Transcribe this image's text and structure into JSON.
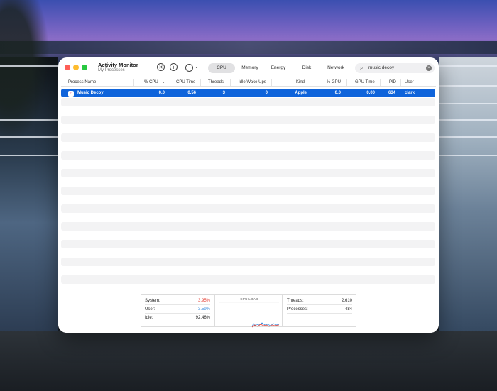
{
  "window": {
    "title": "Activity Monitor",
    "subtitle": "My Processes"
  },
  "toolbar": {
    "stop_icon": "x-circle-icon",
    "info_icon": "info-icon",
    "more_icon": "ellipsis-icon",
    "more_chevron": "⌄"
  },
  "tabs": [
    {
      "label": "CPU",
      "active": true
    },
    {
      "label": "Memory",
      "active": false
    },
    {
      "label": "Energy",
      "active": false
    },
    {
      "label": "Disk",
      "active": false
    },
    {
      "label": "Network",
      "active": false
    }
  ],
  "search": {
    "value": "music decoy"
  },
  "columns": {
    "process_name": "Process Name",
    "cpu": "% CPU",
    "cpu_time": "CPU Time",
    "threads": "Threads",
    "idle_wake_ups": "Idle Wake Ups",
    "kind": "Kind",
    "gpu": "% GPU",
    "gpu_time": "GPU Time",
    "pid": "PID",
    "user": "User"
  },
  "process": {
    "name": "Music Decoy",
    "cpu": "0.0",
    "cpu_time": "0.56",
    "threads": "3",
    "idle_wake_ups": "0",
    "kind": "Apple",
    "gpu": "0.0",
    "gpu_time": "0.00",
    "pid": "634",
    "user": "clark"
  },
  "stats": {
    "system_label": "System:",
    "system_value": "3.95%",
    "system_color": "#e5443a",
    "user_label": "User:",
    "user_value": "3.59%",
    "user_color": "#3d8fe0",
    "idle_label": "Idle:",
    "idle_value": "92.46%",
    "cpu_load_label": "CPU LOAD",
    "threads_label": "Threads:",
    "threads_value": "2,610",
    "processes_label": "Processes:",
    "processes_value": "484"
  },
  "colors": {
    "selection": "#0f64db",
    "accent_red": "#e5443a",
    "accent_blue": "#3d8fe0"
  }
}
